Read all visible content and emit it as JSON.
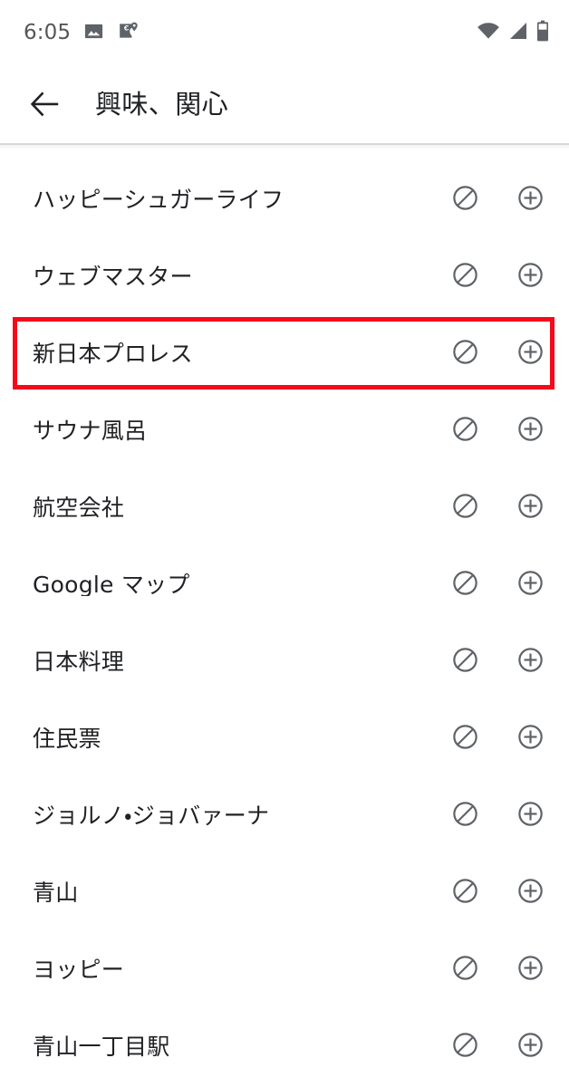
{
  "status_bar": {
    "time": "6:05",
    "left_icons": [
      {
        "name": "photo-icon",
        "label": "画像"
      },
      {
        "name": "google-maps-icon",
        "label": "Google マップ"
      }
    ],
    "right_icons": [
      {
        "name": "wifi-icon",
        "label": "Wi-Fi"
      },
      {
        "name": "cell-signal-icon",
        "label": "モバイル電波"
      },
      {
        "name": "battery-icon",
        "label": "電池"
      }
    ]
  },
  "app_bar": {
    "back_label": "戻る",
    "title": "興味、関心"
  },
  "list": {
    "block_icon_label": "興味なし",
    "add_icon_label": "追加",
    "rows": [
      {
        "label": "ハッピーシュガーライフ",
        "highlighted": false
      },
      {
        "label": "ウェブマスター",
        "highlighted": false
      },
      {
        "label": "新日本プロレス",
        "highlighted": true
      },
      {
        "label": "サウナ風呂",
        "highlighted": false
      },
      {
        "label": "航空会社",
        "highlighted": false
      },
      {
        "label": "Google マップ",
        "highlighted": false
      },
      {
        "label": "日本料理",
        "highlighted": false
      },
      {
        "label": "住民票",
        "highlighted": false
      },
      {
        "label": "ジョルノ・ジョバァーナ",
        "highlighted": false
      },
      {
        "label": "青山",
        "highlighted": false
      },
      {
        "label": "ヨッピー",
        "highlighted": false
      },
      {
        "label": "青山一丁目駅",
        "highlighted": false
      }
    ]
  },
  "colors": {
    "text_primary": "#202124",
    "status_icon": "#5f6368",
    "row_icon": "#5f6368",
    "highlight": "#f5091b",
    "background": "#ffffff",
    "divider": "#d6d7d8"
  }
}
